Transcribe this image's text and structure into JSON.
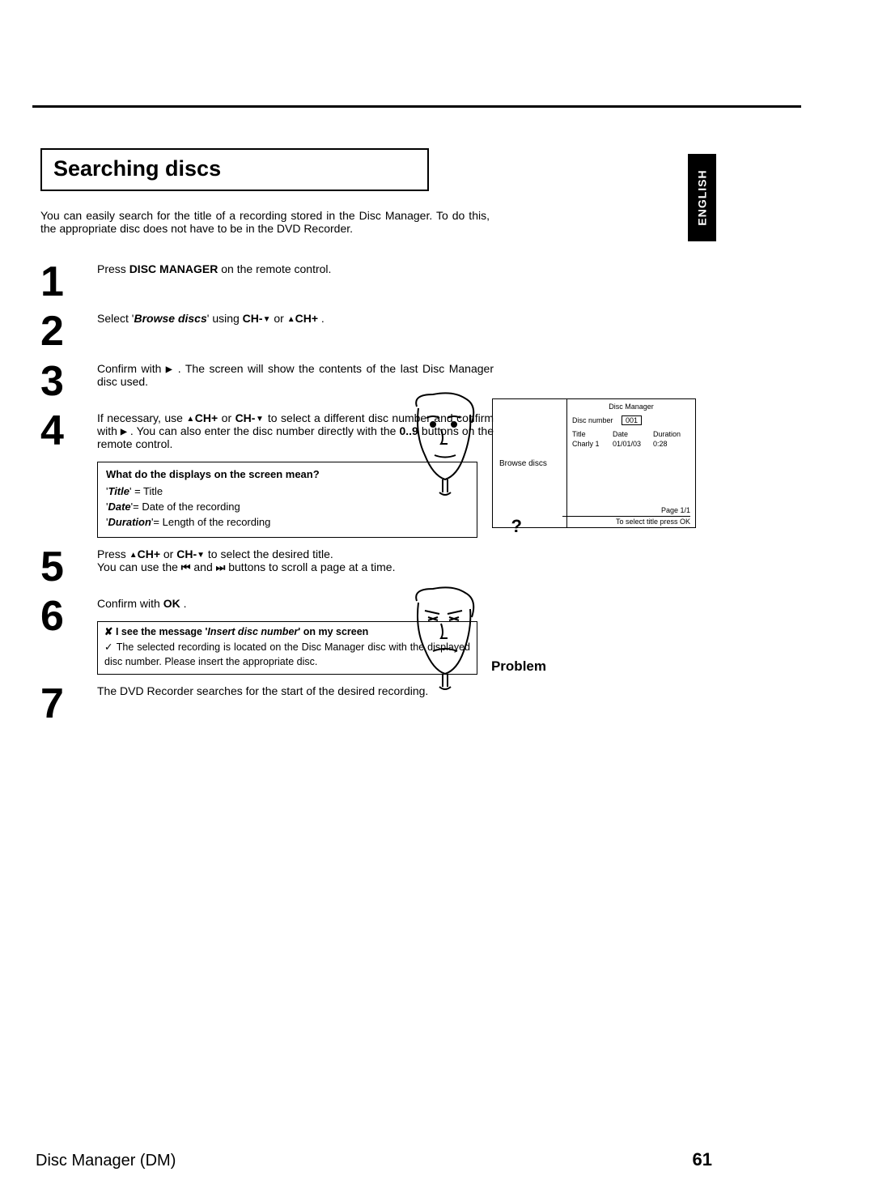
{
  "language_tab": "ENGLISH",
  "section_title": "Searching discs",
  "intro": "You can easily search for the title of a recording stored in the Disc Manager. To do this, the appropriate disc does not have to be in the DVD Recorder.",
  "steps": {
    "s1": {
      "num": "1",
      "t1": "Press ",
      "b1": "DISC MANAGER",
      "t2": " on the remote control."
    },
    "s2": {
      "num": "2",
      "t1": "Select '",
      "b1": "Browse discs",
      "t2": "' using ",
      "k1": "CH-",
      "t3": " or ",
      "k2": "CH+",
      "t4": " ."
    },
    "s3": {
      "num": "3",
      "t1": "Confirm with ",
      "t2": " . The screen will show the contents of the last Disc Manager disc used."
    },
    "s4": {
      "num": "4",
      "t1": "If necessary, use ",
      "k1": "CH+",
      "t2": " or ",
      "k2": "CH-",
      "t3": " to select a different disc number and confirm with ",
      "t4": " . You can also enter the disc number directly with the ",
      "k3": "0..9",
      "t5": " buttons on the remote control."
    },
    "s5": {
      "num": "5",
      "t1": "Press ",
      "k1": "CH+",
      "t2": " or ",
      "k2": "CH-",
      "t3": " to select the desired title.",
      "t4": "You can use the ",
      "t5": " and ",
      "t6": " buttons to scroll a page at a time."
    },
    "s6": {
      "num": "6",
      "t1": "Confirm with ",
      "k1": "OK",
      "t2": " ."
    },
    "s7": {
      "num": "7",
      "t1": "The DVD Recorder searches for the start of the desired recording."
    }
  },
  "callout_q": {
    "title": "What do the displays on the screen mean?",
    "l1a": "Title",
    "l1b": " = Title",
    "l2a": "Date",
    "l2b": "= Date of the recording",
    "l3a": "Duration",
    "l3b": "= Length of the recording"
  },
  "problem": {
    "label": "Problem",
    "mark1": "✘",
    "line1a": "I see the message '",
    "line1b": "Insert disc number",
    "line1c": "' on my screen",
    "mark2": "✓",
    "line2": "The selected recording is located on the Disc Manager disc with the displayed disc number. Please insert the appropriate disc."
  },
  "osd": {
    "left_label": "Browse discs",
    "title": "Disc  Manager",
    "disc_number_label": "Disc number",
    "disc_number_value": "001",
    "hdr1": "Title",
    "hdr2": "Date",
    "hdr3": "Duration",
    "d1": "Charly 1",
    "d2": "01/01/03",
    "d3": "0:28",
    "page": "Page 1/1",
    "hint": "To select title press OK"
  },
  "footer_left": "Disc Manager (DM)",
  "footer_right": "61"
}
